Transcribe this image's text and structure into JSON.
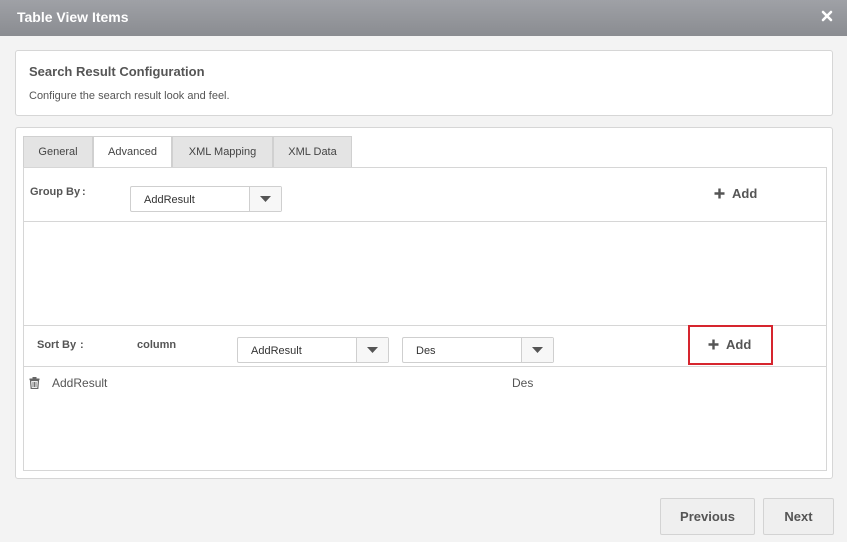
{
  "dialog": {
    "title": "Table View Items",
    "close_icon": "close-icon"
  },
  "header": {
    "title": "Search Result Configuration",
    "description": "Configure the search result look and feel."
  },
  "tabs": [
    {
      "label": "General",
      "active": false
    },
    {
      "label": "Advanced",
      "active": true
    },
    {
      "label": "XML Mapping",
      "active": false
    },
    {
      "label": "XML Data",
      "active": false
    }
  ],
  "group_by": {
    "label": "Group By",
    "colon": ":",
    "select_value": "AddResult",
    "add_label": "Add"
  },
  "sort_by": {
    "label": "Sort By",
    "colon": ":",
    "column_label": "column",
    "column_select_value": "AddResult",
    "order_select_value": "Des",
    "add_label": "Add"
  },
  "sort_rows": [
    {
      "column": "AddResult",
      "order": "Des"
    }
  ],
  "footer": {
    "previous_label": "Previous",
    "next_label": "Next"
  },
  "colors": {
    "title_bar": "#8f9196",
    "highlight": "#d6252e",
    "panel_border": "#d6d6d6"
  }
}
